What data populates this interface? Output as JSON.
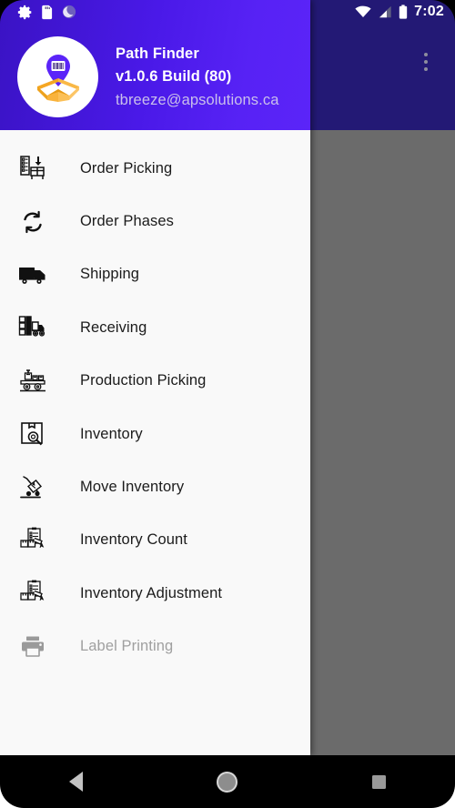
{
  "statusbar": {
    "time": "7:02",
    "left_icons": [
      {
        "name": "settings-gear-icon"
      },
      {
        "name": "sd-card-icon"
      },
      {
        "name": "do-not-disturb-moon-icon"
      }
    ],
    "right_icons": [
      {
        "name": "wifi-icon"
      },
      {
        "name": "cellular-signal-icon"
      },
      {
        "name": "battery-icon"
      }
    ]
  },
  "toolbar": {
    "overflow_label": "More options",
    "background_color": "#231975"
  },
  "drawer": {
    "header": {
      "app_name": "Path Finder",
      "version": "v1.0.6 Build (80)",
      "account_email": "tbreeze@apsolutions.ca",
      "logo_name": "path-finder-logo",
      "gradient_from": "#3a13c4",
      "gradient_to": "#5b24f8"
    },
    "items": [
      {
        "label": "Order Picking",
        "icon": "order-picking-icon",
        "enabled": true
      },
      {
        "label": "Order Phases",
        "icon": "order-phases-sync-icon",
        "enabled": true
      },
      {
        "label": "Shipping",
        "icon": "shipping-truck-icon",
        "enabled": true
      },
      {
        "label": "Receiving",
        "icon": "receiving-forklift-icon",
        "enabled": true
      },
      {
        "label": "Production Picking",
        "icon": "production-conveyor-icon",
        "enabled": true
      },
      {
        "label": "Inventory",
        "icon": "inventory-search-box-icon",
        "enabled": true
      },
      {
        "label": "Move Inventory",
        "icon": "move-inventory-dolly-icon",
        "enabled": true
      },
      {
        "label": "Inventory Count",
        "icon": "inventory-count-icon",
        "enabled": true
      },
      {
        "label": "Inventory Adjustment",
        "icon": "inventory-adjustment-icon",
        "enabled": true
      },
      {
        "label": "Label Printing",
        "icon": "printer-icon",
        "enabled": false
      }
    ]
  },
  "scrim": {
    "color": "#6b6b6b"
  },
  "navbar": {
    "back_label": "Back",
    "home_label": "Home",
    "recents_label": "Recent apps"
  }
}
